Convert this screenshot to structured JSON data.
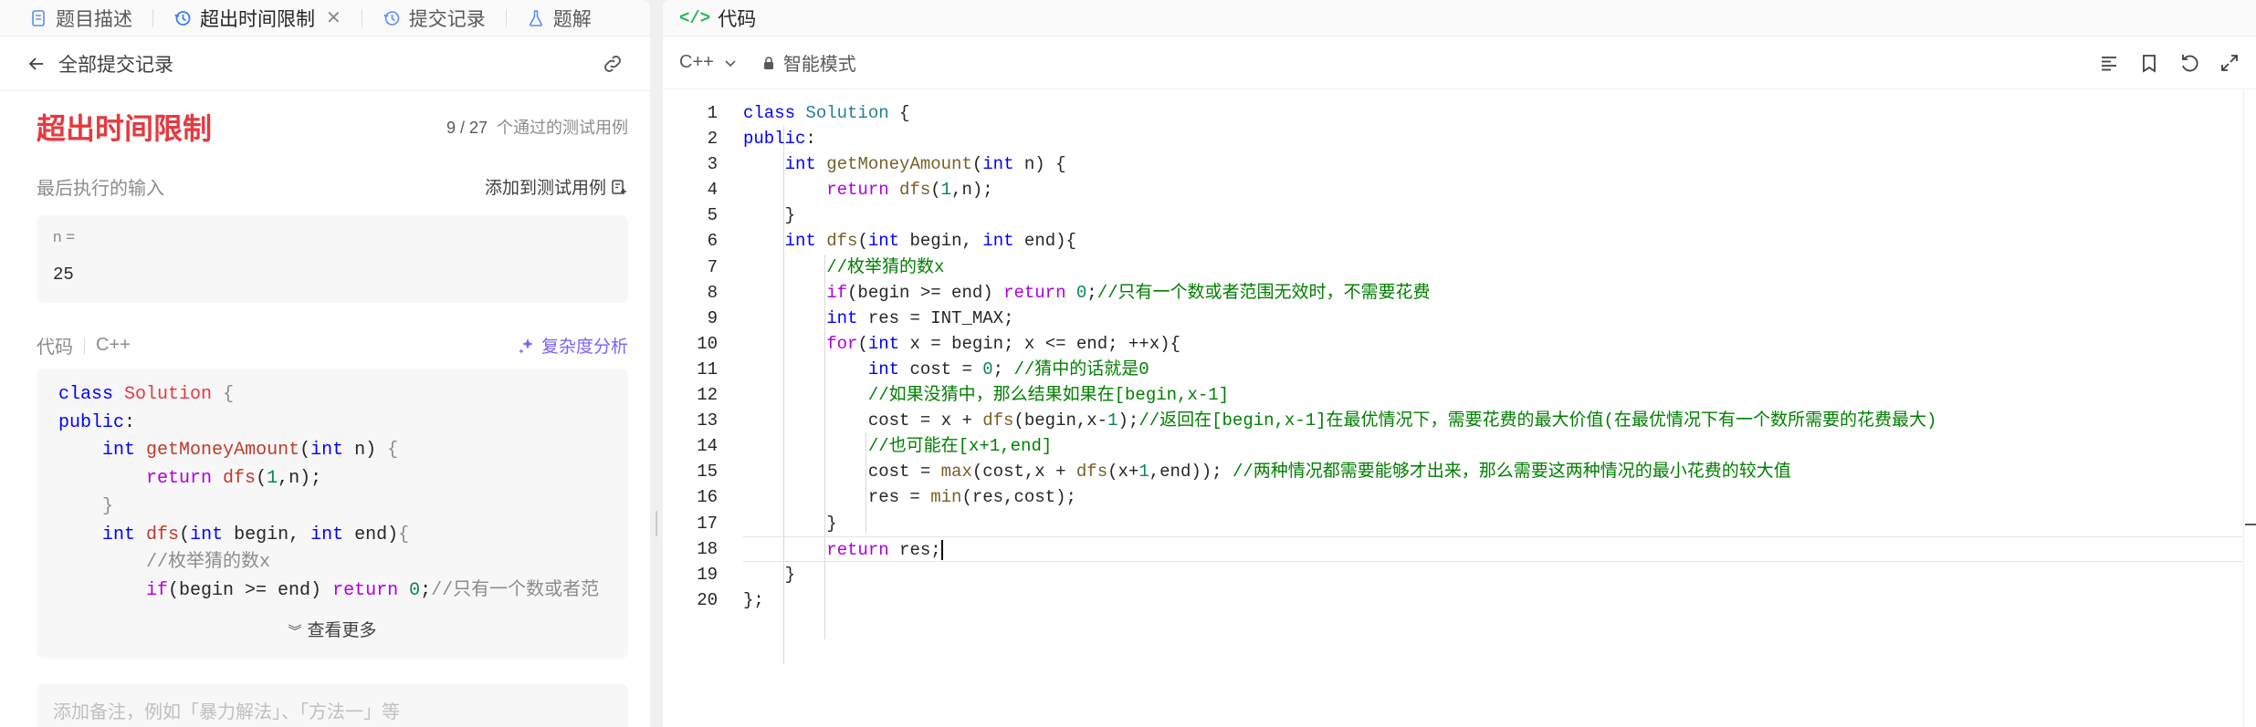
{
  "left": {
    "tabs": [
      {
        "label": "题目描述",
        "icon": "document-icon"
      },
      {
        "label": "超出时间限制",
        "icon": "history-icon",
        "active": true,
        "closable": true
      },
      {
        "label": "提交记录",
        "icon": "history-icon"
      },
      {
        "label": "题解",
        "icon": "flask-icon"
      }
    ],
    "back_label": "全部提交记录",
    "status": "超出时间限制",
    "passed_count": "9 / 27",
    "passed_label": "个通过的测试用例",
    "last_input_label": "最后执行的输入",
    "add_test_label": "添加到测试用例",
    "input_key": "n =",
    "input_value": "25",
    "code_label": "代码",
    "code_lang": "C++",
    "complexity_label": "复杂度分析",
    "see_more_label": "查看更多",
    "note_placeholder": "添加备注，例如「暴力解法」、「方法一」等"
  },
  "right": {
    "tab_label": "代码",
    "language": "C++",
    "mode": "智能模式",
    "line_numbers": [
      "1",
      "2",
      "3",
      "4",
      "5",
      "6",
      "7",
      "8",
      "9",
      "10",
      "11",
      "12",
      "13",
      "14",
      "15",
      "16",
      "17",
      "18",
      "19",
      "20"
    ]
  },
  "colors": {
    "status_red": "#e6393f",
    "accent_purple": "#7b61ff",
    "code_green": "#2db55d"
  }
}
